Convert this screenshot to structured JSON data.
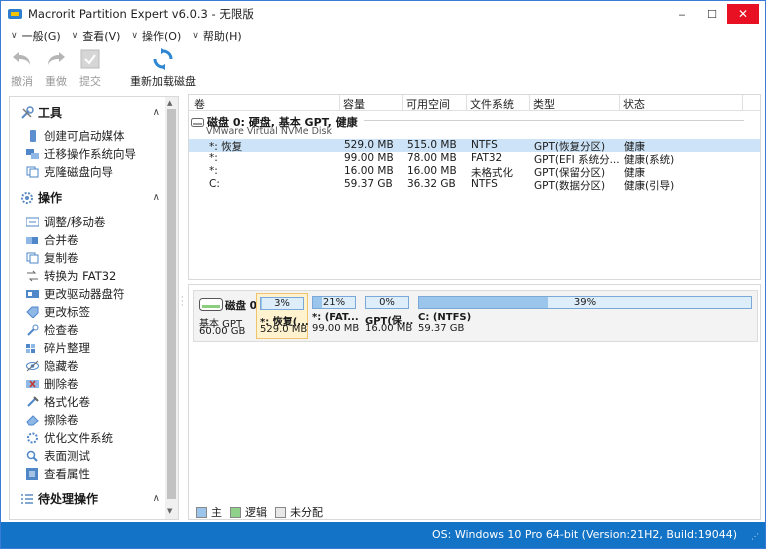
{
  "window": {
    "title": "Macrorit Partition Expert v6.0.3 - 无限版",
    "controls": {
      "minimize": "‒",
      "maximize": "☐",
      "close": "✕"
    }
  },
  "menu": [
    {
      "label": "一般(G)"
    },
    {
      "label": "查看(V)"
    },
    {
      "label": "操作(O)"
    },
    {
      "label": "帮助(H)"
    }
  ],
  "toolbar": {
    "undo": "撤消",
    "redo": "重做",
    "commit": "提交",
    "reload": "重新加载磁盘"
  },
  "sidebar": {
    "tools": {
      "title": "工具",
      "items": [
        "创建可启动媒体",
        "迁移操作系统向导",
        "克隆磁盘向导"
      ]
    },
    "operations": {
      "title": "操作",
      "items": [
        "调整/移动卷",
        "合并卷",
        "复制卷",
        "转换为 FAT32",
        "更改驱动器盘符",
        "更改标签",
        "检查卷",
        "碎片整理",
        "隐藏卷",
        "删除卷",
        "格式化卷",
        "擦除卷",
        "优化文件系统",
        "表面测试",
        "查看属性"
      ]
    },
    "pending": {
      "title": "待处理操作"
    }
  },
  "table": {
    "columns": [
      "卷",
      "容量",
      "可用空间",
      "文件系统",
      "类型",
      "状态"
    ],
    "disk": {
      "title": "磁盘 0: 硬盘, 基本 GPT, 健康",
      "subtitle": "VMware Virtual NVMe Disk"
    },
    "rows": [
      {
        "volume": "*: 恢复",
        "capacity": "529.0 MB",
        "free": "515.0 MB",
        "fs": "NTFS",
        "type": "GPT(恢复分区)",
        "status": "健康"
      },
      {
        "volume": "*:",
        "capacity": "99.00 MB",
        "free": "78.00 MB",
        "fs": "FAT32",
        "type": "GPT(EFI 系统分...",
        "status": "健康(系统)"
      },
      {
        "volume": "*:",
        "capacity": "16.00 MB",
        "free": "16.00 MB",
        "fs": "未格式化",
        "type": "GPT(保留分区)",
        "status": "健康"
      },
      {
        "volume": "C:",
        "capacity": "59.37 GB",
        "free": "36.32 GB",
        "fs": "NTFS",
        "type": "GPT(数据分区)",
        "status": "健康(引导)"
      }
    ],
    "more": "....."
  },
  "diskmap": {
    "disk": {
      "name": "磁盘 0",
      "line1": "基本 GPT",
      "line2": "60.00 GB"
    },
    "partitions": [
      {
        "pct": "3%",
        "fill": 0.03,
        "name": "*: 恢复(...",
        "size": "529.0 MB"
      },
      {
        "pct": "21%",
        "fill": 0.21,
        "name": "*: (FAT...",
        "size": "99.00 MB"
      },
      {
        "pct": "0%",
        "fill": 0.0,
        "name": "GPT(保...",
        "size": "16.00 MB"
      },
      {
        "pct": "39%",
        "fill": 0.39,
        "name": "C: (NTFS)",
        "size": "59.37 GB"
      }
    ]
  },
  "legend": [
    {
      "label": "主",
      "color": "#9cc5ec"
    },
    {
      "label": "逻辑",
      "color": "#8fd18a"
    },
    {
      "label": "未分配",
      "color": "#e8e8e8"
    }
  ],
  "status": {
    "text": "OS: Windows 10 Pro 64-bit (Version:21H2, Build:19044)"
  },
  "colors": {
    "accent": "#1373c6",
    "selection": "#cde3f7"
  }
}
